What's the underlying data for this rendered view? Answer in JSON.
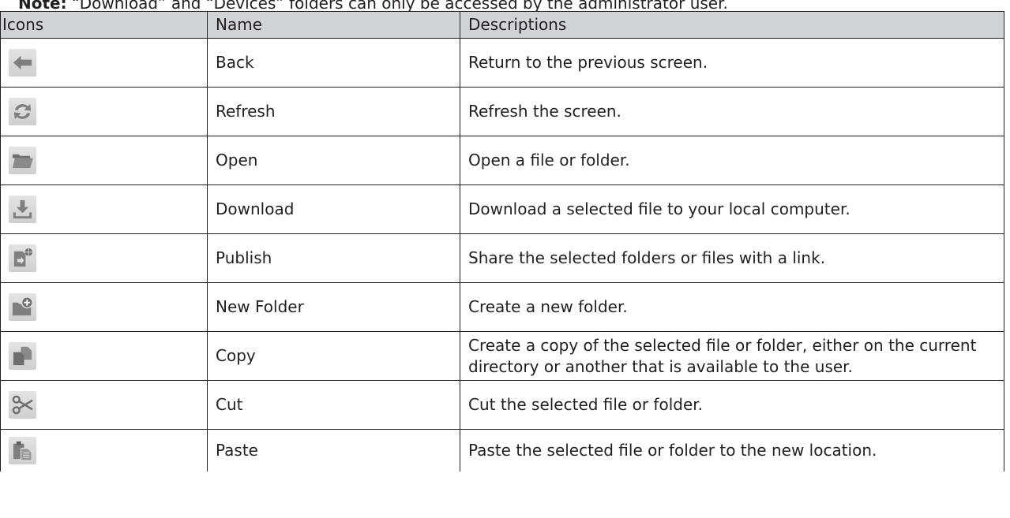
{
  "note": {
    "label": "Note:",
    "text": " “Download” and “Devices” folders can only be accessed by the administrator user."
  },
  "table": {
    "headers": [
      "Icons",
      "Name",
      "Descriptions"
    ],
    "rows": [
      {
        "icon": "back-arrow-icon",
        "name": "Back",
        "description": "Return to the previous screen."
      },
      {
        "icon": "refresh-icon",
        "name": "Refresh",
        "description": "Refresh the screen."
      },
      {
        "icon": "open-folder-icon",
        "name": "Open",
        "description": "Open a file or folder."
      },
      {
        "icon": "download-icon",
        "name": "Download",
        "description": "Download a selected file to your local computer."
      },
      {
        "icon": "publish-icon",
        "name": "Publish",
        "description": "Share the selected folders or files with a link."
      },
      {
        "icon": "new-folder-icon",
        "name": "New Folder",
        "description": "Create a new folder."
      },
      {
        "icon": "copy-icon",
        "name": "Copy",
        "description": "Create a copy of the selected file or folder, either on the current directory or another that is available to the user."
      },
      {
        "icon": "cut-icon",
        "name": "Cut",
        "description": "Cut the selected file or folder."
      },
      {
        "icon": "paste-icon",
        "name": "Paste",
        "description": "Paste the selected file or folder to the new location."
      }
    ]
  },
  "colors": {
    "header_bg": "#d1d3d4",
    "border": "#231f20",
    "icon_fg": "#7f7f7f"
  }
}
